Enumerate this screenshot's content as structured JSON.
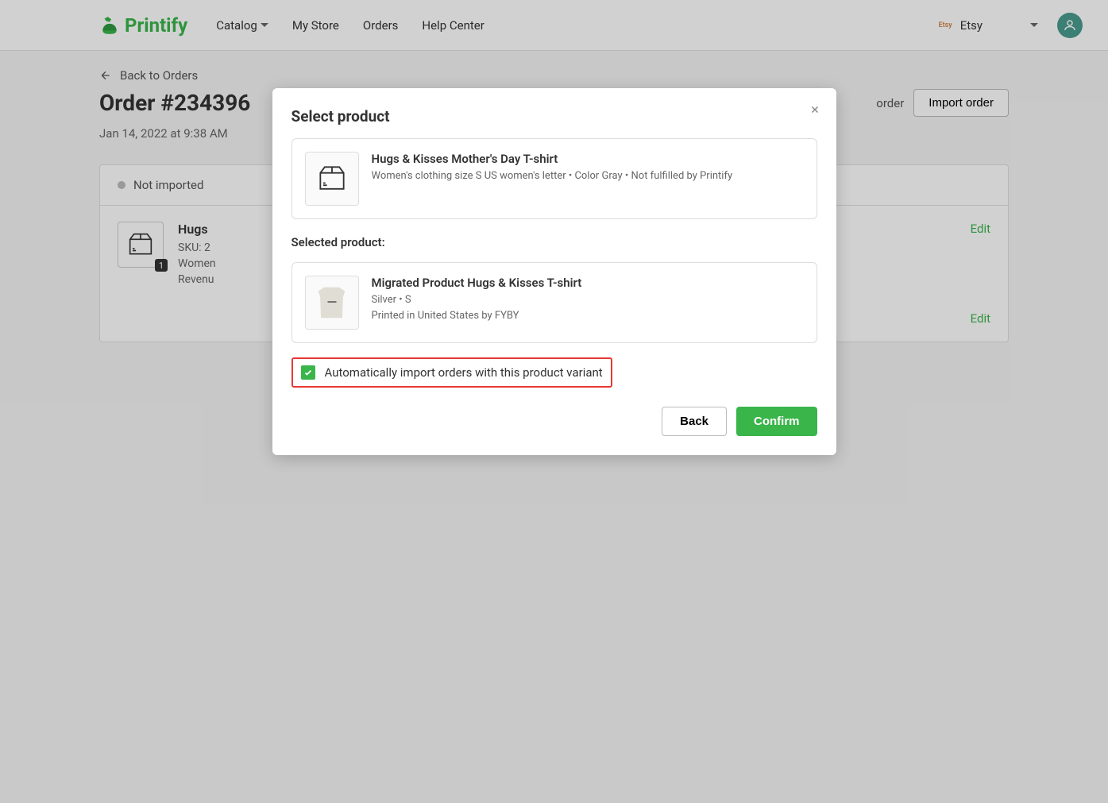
{
  "header": {
    "logo": "Printify",
    "nav": {
      "catalog": "Catalog",
      "my_store": "My Store",
      "orders": "Orders",
      "help": "Help Center"
    },
    "store_badge": "Etsy",
    "store_name": "Etsy"
  },
  "page": {
    "back": "Back to Orders",
    "title": "Order #234396",
    "import_btn": "Import order",
    "other_action": "order",
    "timestamp": "Jan 14, 2022 at 9:38 AM"
  },
  "order_card": {
    "status": "Not imported",
    "qty": "1",
    "name": "Hugs ",
    "sku": "SKU: 2",
    "variant": "Women",
    "revenue": "Revenu",
    "edit": "Edit"
  },
  "modal": {
    "title": "Select product",
    "original": {
      "name": "Hugs & Kisses Mother's Day T-shirt",
      "meta": "Women's clothing size S US women's letter • Color Gray • Not fulfilled by Printify"
    },
    "selected_label": "Selected product:",
    "selected": {
      "name": "Migrated Product Hugs & Kisses T-shirt",
      "variant": "Silver  •   S",
      "printed": "Printed in United States by FYBY"
    },
    "checkbox_label": "Automatically import orders with this product variant",
    "back": "Back",
    "confirm": "Confirm"
  }
}
